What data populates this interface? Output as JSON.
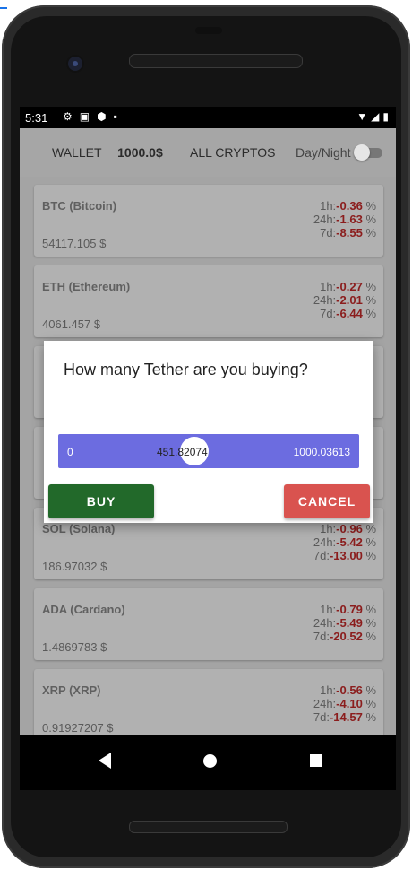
{
  "status_bar": {
    "time": "5:31",
    "right_icons": [
      "wifi-icon",
      "signal-icon",
      "battery-icon"
    ]
  },
  "app_bar": {
    "wallet_label": "WALLET",
    "wallet_amount": "1000.0$",
    "all_cryptos": "ALL CRYPTOS",
    "daynight_label": "Day/Night"
  },
  "cryptos": [
    {
      "name": "BTC (Bitcoin)",
      "price": "54117.105 $",
      "h1_label": "1h:",
      "h1": "-0.36",
      "h24_label": "24h:",
      "h24": "-1.63",
      "d7_label": "7d:",
      "d7": "-8.55",
      "unit": "%"
    },
    {
      "name": "ETH (Ethereum)",
      "price": "4061.457 $",
      "h1_label": "1h:",
      "h1": "-0.27",
      "h24_label": "24h:",
      "h24": "-2.01",
      "d7_label": "7d:",
      "d7": "-6.44",
      "unit": "%"
    },
    {
      "name": "SOL (Solana)",
      "price": "186.97032 $",
      "h1_label": "1h:",
      "h1": "-0.96",
      "h24_label": "24h:",
      "h24": "-5.42",
      "d7_label": "7d:",
      "d7": "-13.00",
      "unit": "%"
    },
    {
      "name": "ADA (Cardano)",
      "price": "1.4869783 $",
      "h1_label": "1h:",
      "h1": "-0.79",
      "h24_label": "24h:",
      "h24": "-5.49",
      "d7_label": "7d:",
      "d7": "-20.52",
      "unit": "%"
    },
    {
      "name": "XRP (XRP)",
      "price": "0.91927207 $",
      "h1_label": "1h:",
      "h1": "-0.56",
      "h24_label": "24h:",
      "h24": "-4.10",
      "d7_label": "7d:",
      "d7": "-14.57",
      "unit": "%"
    }
  ],
  "dialog": {
    "question": "How many Tether are you buying?",
    "slider_min": "0",
    "slider_value": "451.82074",
    "slider_max": "1000.03613",
    "buy_label": "BUY",
    "cancel_label": "CANCEL"
  },
  "colors": {
    "accent_slider": "#6c6ce0",
    "buy": "#22692a",
    "cancel": "#d9534f",
    "negative": "#8b1d1d"
  }
}
